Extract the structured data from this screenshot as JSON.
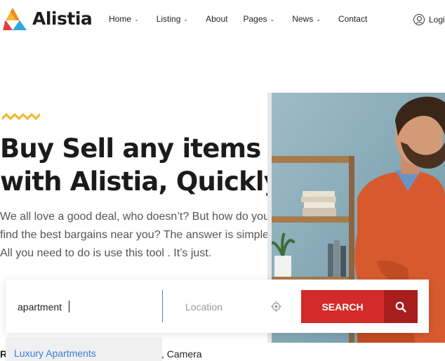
{
  "header": {
    "logo_text": "Alistia",
    "nav": [
      {
        "label": "Home",
        "has_dropdown": true
      },
      {
        "label": "Listing",
        "has_dropdown": true
      },
      {
        "label": "About",
        "has_dropdown": false
      },
      {
        "label": "Pages",
        "has_dropdown": true
      },
      {
        "label": "News",
        "has_dropdown": true
      },
      {
        "label": "Contact",
        "has_dropdown": false
      }
    ],
    "login_label": "Logi"
  },
  "hero": {
    "title_line1": "Buy Sell any items",
    "title_line2": "with Alistia, Quickly!",
    "subtitle_line1": "We all love a good deal, who doesn’t? But how do you",
    "subtitle_line2": "find the best bargains near you? The answer is simple",
    "subtitle_line3": "All you need to do is use this tool . It’s just."
  },
  "search": {
    "keyword_value": "apartment",
    "location_placeholder": "Location",
    "button_label": "SEARCH"
  },
  "autocomplete": {
    "items": [
      "Luxury Apartments"
    ]
  },
  "below": {
    "left_text": "R",
    "right_text": ", Camera"
  },
  "colors": {
    "accent_red": "#d32a2a",
    "accent_red_dark": "#a81d1d",
    "squiggle_yellow": "#f5b82e",
    "link_blue": "#3a7bd5"
  }
}
